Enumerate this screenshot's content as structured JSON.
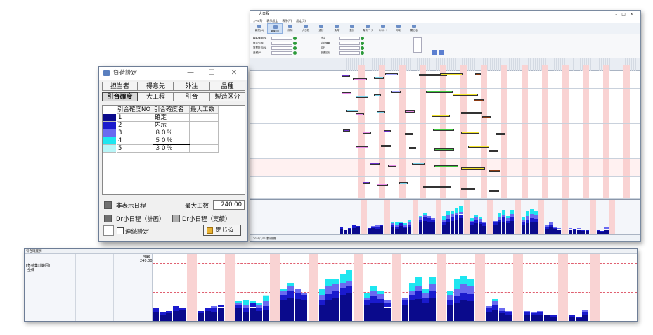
{
  "main_window": {
    "title": "大日程",
    "menu": [
      "ﾌｧｲﾙ(F)",
      "表示設定",
      "表示(V)",
      "設定(S)"
    ],
    "toolbar": [
      "新規(N)",
      "編集(E)",
      "削除",
      "大日程",
      "進捗",
      "負荷",
      "集計",
      "負荷ﾃﾞｰﾀ",
      "ﾏｲﾙｽﾄｰﾝ",
      "印刷",
      "閉じる"
    ],
    "filters": [
      "顧客情報(N)",
      "得意先(N)",
      "営業担当(N)",
      "品種(N)",
      "外注",
      "引合情報",
      "区分",
      "製造区分"
    ],
    "status": "2021/7/31  表示期間"
  },
  "dialog": {
    "title": "負荷設定",
    "controls": {
      "min": "—",
      "max": "☐",
      "close": "✕"
    },
    "tabs_row1": [
      "担当者",
      "得意先",
      "外注",
      "品種"
    ],
    "tabs_row2": [
      "引合確度",
      "大工程",
      "引合",
      "製造区分"
    ],
    "selected_tab": "引合確度",
    "columns": [
      "引合確度NO",
      "引合確度名",
      "最大工数"
    ],
    "rows": [
      {
        "no": "1",
        "name": "確定",
        "max": "",
        "color": "#0a0a8c"
      },
      {
        "no": "2",
        "name": "内示",
        "max": "",
        "color": "#1a1acd"
      },
      {
        "no": "3",
        "name": "８０％",
        "max": "",
        "color": "#6a6af0"
      },
      {
        "no": "4",
        "name": "５０％",
        "max": "",
        "color": "#1ee6f0"
      },
      {
        "no": "5",
        "name": "３０％",
        "max": "",
        "color": "#b8f6f8"
      }
    ],
    "legend": {
      "hidden": "非表示日程",
      "max_label": "最大工数",
      "max_value": "240.00",
      "dr_plan": "Dr小日程（計画）",
      "dr_actual": "Dr小日程（実績）",
      "hidden_color": "#707070",
      "dr_plan_color": "#707070",
      "dr_actual_color": "#b0b0b0"
    },
    "continuous": "連続設定",
    "close_button": "閉じる"
  },
  "zoom": {
    "header": "引合確度別",
    "left_label_1": "[負荷集計範囲]",
    "left_label_2": "全体",
    "max_label": "Max",
    "max_value": "240.00"
  },
  "chart_data": {
    "type": "bar",
    "title": "",
    "stacked": true,
    "ymax": 240,
    "series_colors": [
      "#0a0a8c",
      "#1a1acd",
      "#6a6af0",
      "#1ee6f0",
      "#b8f6f8"
    ],
    "groups": [
      [
        [
          40,
          15,
          0,
          0,
          0
        ],
        [
          30,
          10,
          0,
          0,
          0
        ],
        [
          35,
          10,
          0,
          0,
          0
        ],
        [
          45,
          20,
          0,
          0,
          0
        ],
        [
          50,
          10,
          0,
          0,
          0
        ]
      ],
      [
        [
          35,
          10,
          0,
          0,
          0
        ],
        [
          45,
          10,
          5,
          0,
          0
        ],
        [
          40,
          15,
          10,
          0,
          0
        ],
        [
          60,
          10,
          0,
          0,
          0
        ]
      ],
      [
        [
          55,
          15,
          10,
          5,
          0
        ],
        [
          40,
          15,
          15,
          20,
          0
        ],
        [
          60,
          20,
          0,
          5,
          0
        ],
        [
          45,
          10,
          15,
          10,
          0
        ],
        [
          50,
          15,
          20,
          20,
          5
        ]
      ],
      [
        [
          90,
          20,
          15,
          10,
          0
        ],
        [
          100,
          25,
          20,
          15,
          0
        ],
        [
          95,
          25,
          15,
          0,
          0
        ],
        [
          90,
          20,
          10,
          0,
          0
        ]
      ],
      [
        [
          70,
          20,
          20,
          25,
          0
        ],
        [
          90,
          25,
          30,
          30,
          0
        ],
        [
          100,
          30,
          25,
          20,
          0
        ],
        [
          110,
          30,
          20,
          35,
          0
        ],
        [
          120,
          30,
          20,
          45,
          0
        ]
      ],
      [
        [
          70,
          20,
          10,
          20,
          0
        ],
        [
          80,
          25,
          25,
          15,
          0
        ],
        [
          75,
          20,
          20,
          10,
          0
        ],
        [
          60,
          20,
          10,
          0,
          0
        ]
      ],
      [
        [
          70,
          20,
          10,
          0,
          0
        ],
        [
          90,
          20,
          15,
          35,
          0
        ],
        [
          95,
          30,
          20,
          40,
          0
        ],
        [
          80,
          20,
          20,
          15,
          0
        ],
        [
          100,
          30,
          25,
          30,
          0
        ]
      ],
      [
        [
          70,
          20,
          20,
          15,
          0
        ],
        [
          80,
          25,
          30,
          40,
          0
        ],
        [
          90,
          30,
          35,
          35,
          0
        ],
        [
          85,
          30,
          30,
          30,
          0
        ]
      ],
      [
        [
          40,
          15,
          10,
          0,
          0
        ],
        [
          50,
          20,
          15,
          10,
          0
        ],
        [
          35,
          10,
          10,
          0,
          0
        ],
        [
          30,
          10,
          5,
          0,
          0
        ]
      ],
      [
        [
          30,
          10,
          5,
          0,
          0
        ],
        [
          25,
          10,
          5,
          0,
          0
        ],
        [
          30,
          10,
          5,
          0,
          0
        ],
        [
          25,
          5,
          0,
          0,
          0
        ],
        [
          20,
          5,
          0,
          0,
          0
        ]
      ],
      [
        [
          20,
          5,
          0,
          0,
          0
        ],
        [
          15,
          5,
          0,
          0,
          0
        ],
        [
          30,
          10,
          10,
          0,
          0
        ]
      ]
    ]
  }
}
